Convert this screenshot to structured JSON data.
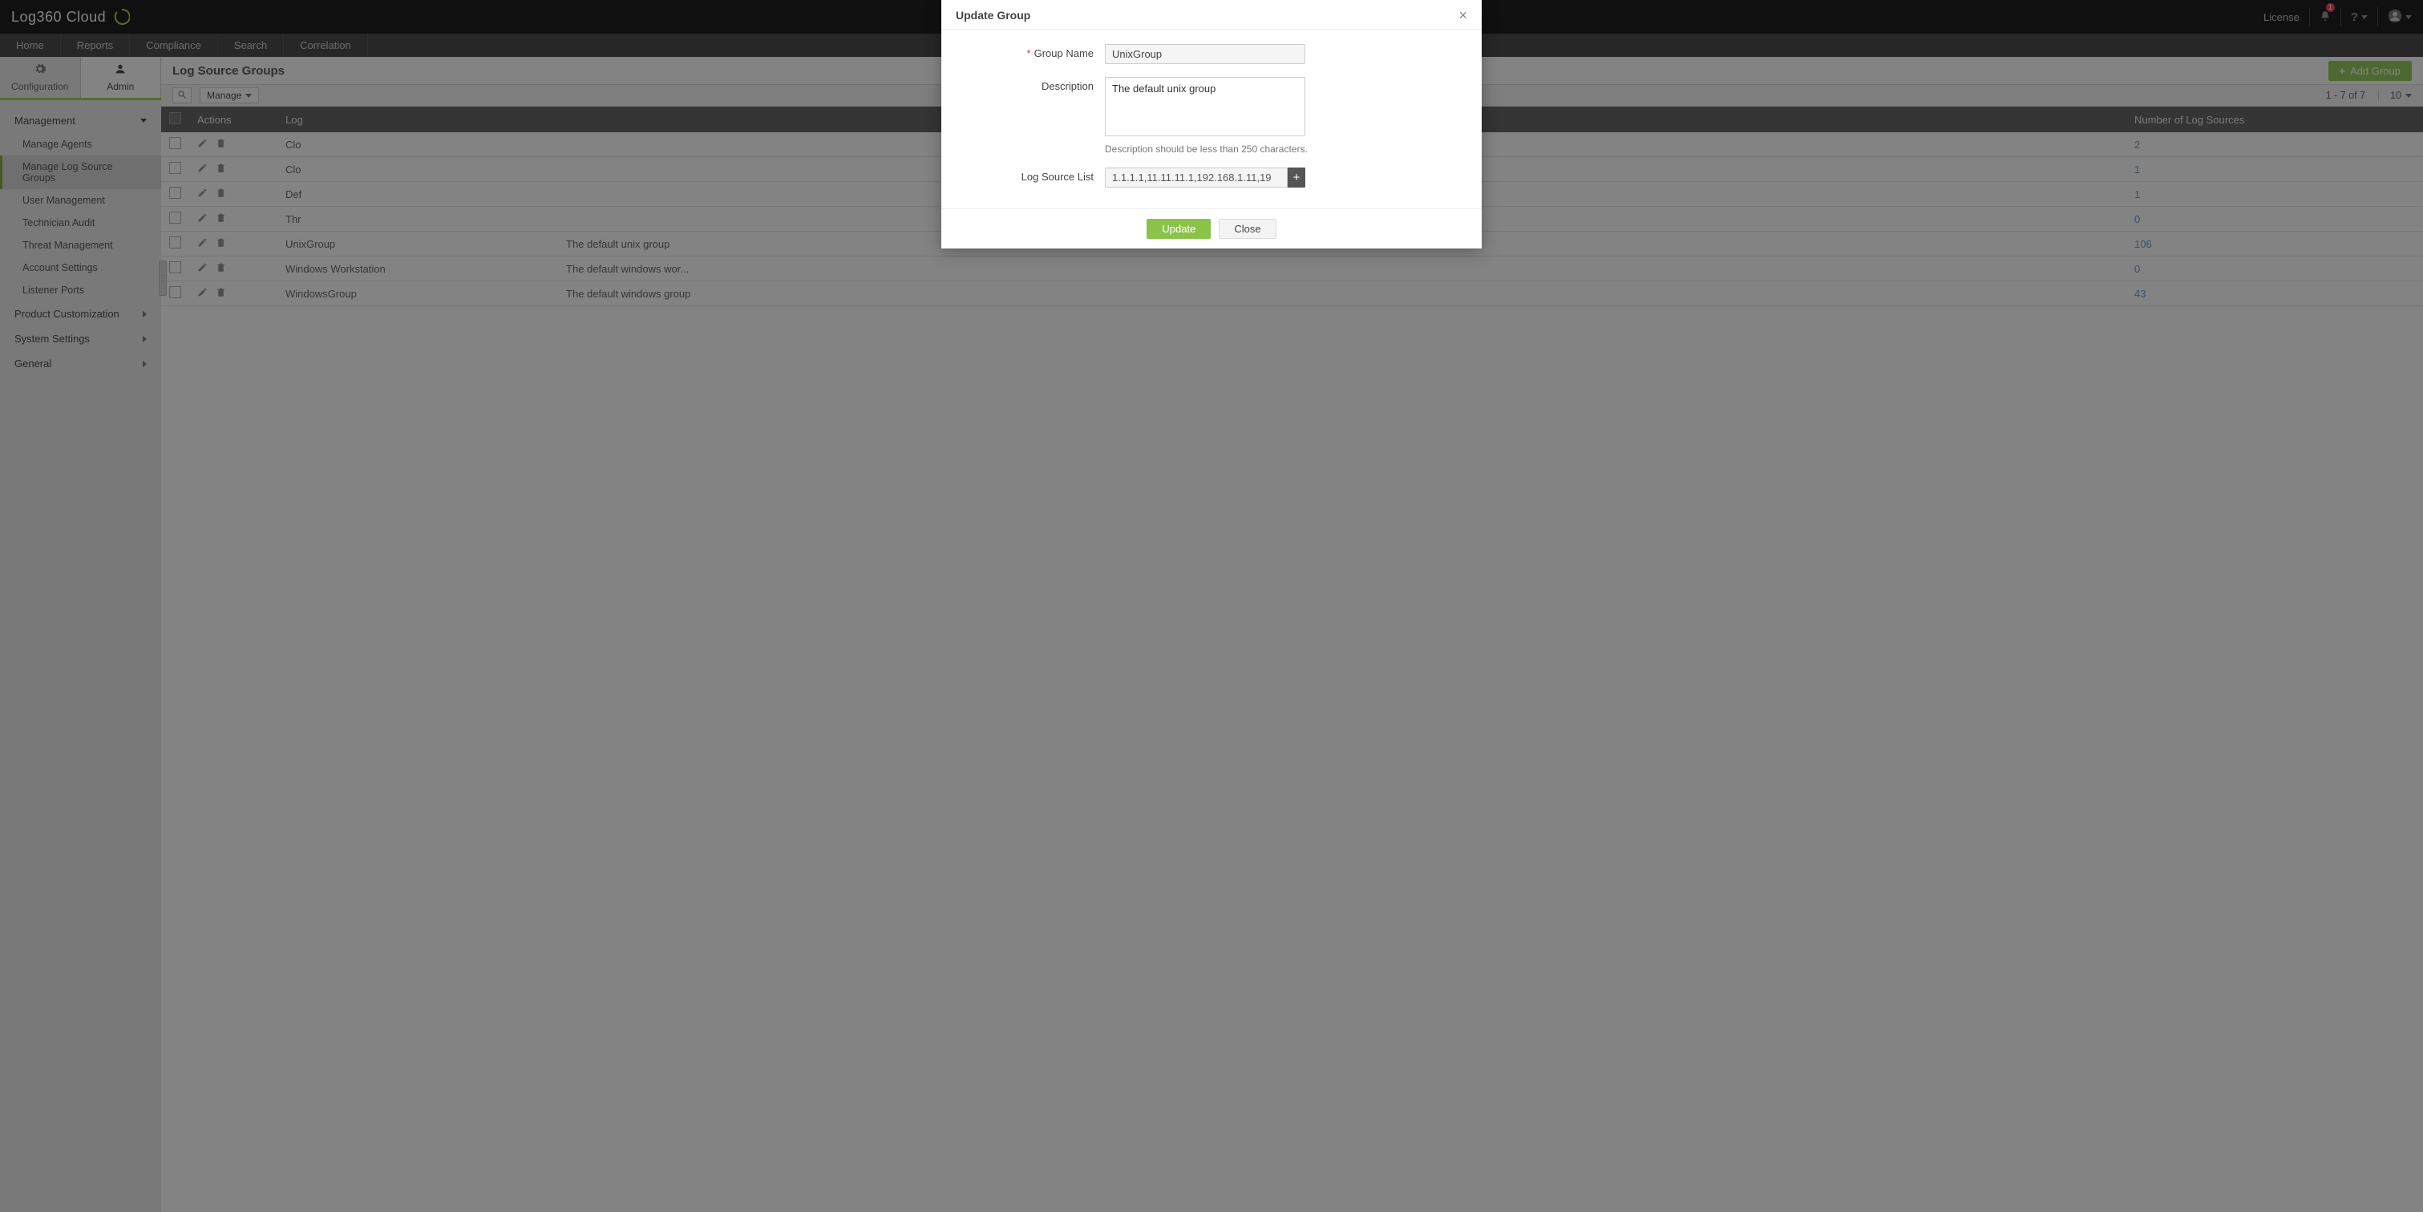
{
  "brand": "Log360  Cloud",
  "top_links": {
    "license": "License",
    "notif_count": "1"
  },
  "nav": [
    "Home",
    "Reports",
    "Compliance",
    "Search",
    "Correlation"
  ],
  "tabs": {
    "configuration": "Configuration",
    "admin": "Admin"
  },
  "sidebar": {
    "groups": [
      {
        "label": "Management",
        "expanded": true,
        "items": [
          "Manage Agents",
          "Manage Log Source Groups",
          "User Management",
          "Technician Audit",
          "Threat Management",
          "Account Settings",
          "Listener Ports"
        ]
      },
      {
        "label": "Product Customization",
        "expanded": false
      },
      {
        "label": "System Settings",
        "expanded": false
      },
      {
        "label": "General",
        "expanded": false
      }
    ],
    "active_item": "Manage Log Source Groups"
  },
  "page": {
    "title": "Log Source Groups",
    "add_btn": "Add Group",
    "manage_btn": "Manage",
    "pagination": "1 - 7 of 7",
    "page_size": "10"
  },
  "table": {
    "headers": [
      "",
      "Actions",
      "Log",
      "",
      "Number of Log Sources"
    ],
    "rows": [
      {
        "name": "Clo",
        "desc": "",
        "count": "2"
      },
      {
        "name": "Clo",
        "desc": "",
        "count": "1"
      },
      {
        "name": "Def",
        "desc": "",
        "count": "1"
      },
      {
        "name": "Thr",
        "desc": "",
        "count": "0"
      },
      {
        "name": "UnixGroup",
        "desc": "The default unix group",
        "count": "106"
      },
      {
        "name": "Windows Workstation",
        "desc": "The default windows wor...",
        "count": "0"
      },
      {
        "name": "WindowsGroup",
        "desc": "The default windows group",
        "count": "43"
      }
    ]
  },
  "modal": {
    "title": "Update Group",
    "labels": {
      "group_name": "Group Name",
      "description": "Description",
      "log_source_list": "Log Source List"
    },
    "values": {
      "group_name": "UnixGroup",
      "description": "The default unix group",
      "log_source_list": "1.1.1.1,11.11.11.1,192.168.1.11,19"
    },
    "help": "Description should be less than 250 characters.",
    "buttons": {
      "update": "Update",
      "close": "Close"
    }
  }
}
